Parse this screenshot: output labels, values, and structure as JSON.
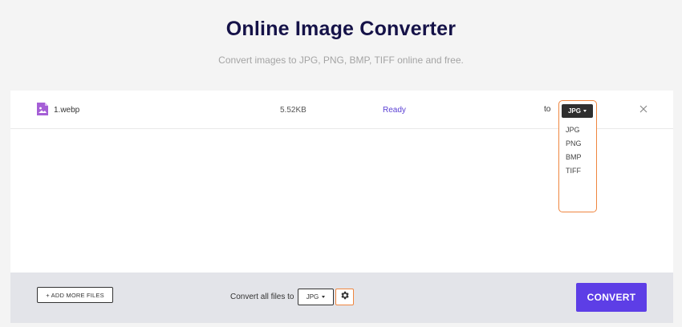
{
  "header": {
    "title": "Online Image Converter",
    "subtitle": "Convert images to JPG, PNG, BMP, TIFF online and free."
  },
  "files": [
    {
      "name": "1.webp",
      "size": "5.52KB",
      "status": "Ready",
      "to_label": "to",
      "selected_format": "JPG",
      "format_options": [
        "JPG",
        "PNG",
        "BMP",
        "TIFF"
      ]
    }
  ],
  "bottom": {
    "add_files_label": "+ ADD MORE FILES",
    "convert_all_label": "Convert all files to",
    "all_format": "JPG",
    "convert_label": "CONVERT"
  },
  "icons": {
    "file": "image-file-icon",
    "remove": "close-icon",
    "settings": "gear-icon"
  },
  "colors": {
    "title": "#151248",
    "accent": "#5d3ee6",
    "status": "#5a3fd4",
    "highlight": "#ef8640",
    "bottom_bar": "#e3e4e9"
  }
}
